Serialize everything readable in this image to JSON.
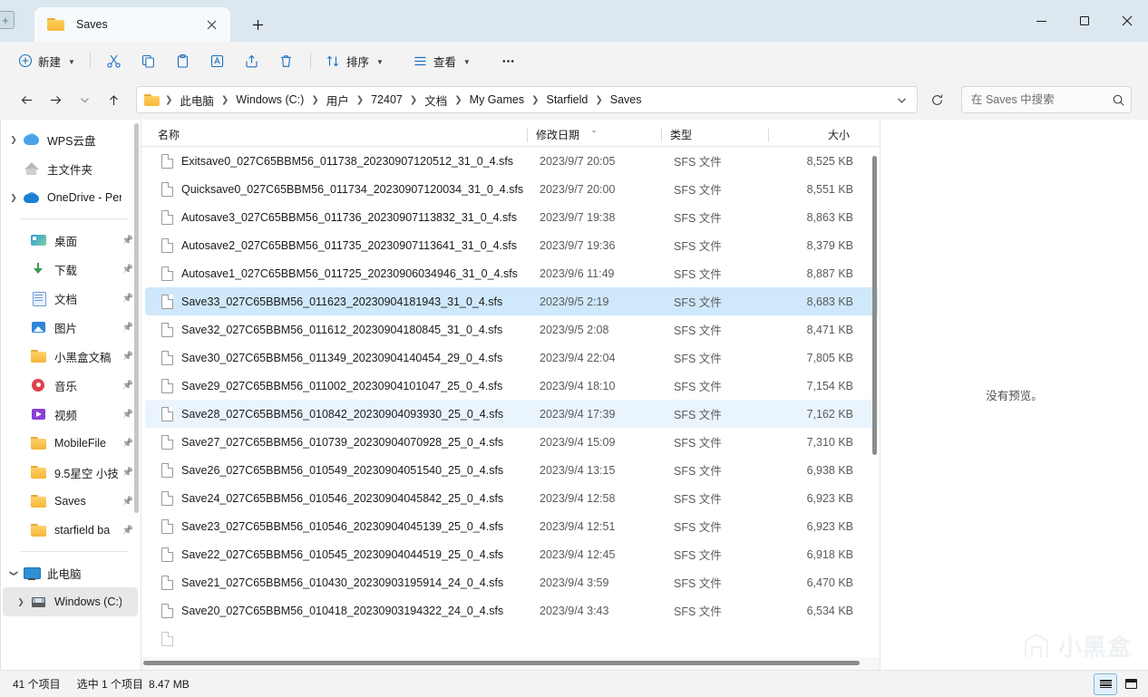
{
  "window": {
    "tab_title": "Saves",
    "controls": {
      "minimize": "–",
      "maximize": "▢",
      "close": "✕",
      "newtab": "+"
    }
  },
  "toolbar": {
    "new_label": "新建",
    "sort_label": "排序",
    "view_label": "查看",
    "more_label": "···",
    "icons": [
      "cut-icon",
      "copy-icon",
      "paste-icon",
      "rename-icon",
      "share-icon",
      "delete-icon"
    ]
  },
  "addressbar": {
    "back": "←",
    "forward": "→",
    "recent": "⌄",
    "up": "↑",
    "crumbs": [
      "此电脑",
      "Windows (C:)",
      "用户",
      "72407",
      "文档",
      "My Games",
      "Starfield",
      "Saves"
    ],
    "dropdown": "⌄",
    "refresh": "⟳",
    "search_placeholder": "在 Saves 中搜索",
    "search_value": ""
  },
  "sidebar": {
    "items": [
      {
        "label": "WPS云盘",
        "icon": "cloud-wps-icon",
        "expandable": true,
        "pinned": false,
        "indent": 0
      },
      {
        "label": "主文件夹",
        "icon": "home-icon",
        "expandable": false,
        "pinned": false,
        "indent": 0
      },
      {
        "label": "OneDrive - Per",
        "icon": "cloud-onedrive-icon",
        "expandable": true,
        "pinned": false,
        "indent": 0
      },
      {
        "separator": true
      },
      {
        "label": "桌面",
        "icon": "desktop-icon",
        "expandable": false,
        "pinned": true,
        "indent": 1
      },
      {
        "label": "下载",
        "icon": "download-icon",
        "expandable": false,
        "pinned": true,
        "indent": 1
      },
      {
        "label": "文档",
        "icon": "documents-icon",
        "expandable": false,
        "pinned": true,
        "indent": 1
      },
      {
        "label": "图片",
        "icon": "pictures-icon",
        "expandable": false,
        "pinned": true,
        "indent": 1
      },
      {
        "label": "小黑盒文稿",
        "icon": "folder-icon",
        "expandable": false,
        "pinned": true,
        "indent": 1
      },
      {
        "label": "音乐",
        "icon": "music-icon",
        "expandable": false,
        "pinned": true,
        "indent": 1
      },
      {
        "label": "视频",
        "icon": "video-icon",
        "expandable": false,
        "pinned": true,
        "indent": 1
      },
      {
        "label": "MobileFile",
        "icon": "folder-icon",
        "expandable": false,
        "pinned": true,
        "indent": 1
      },
      {
        "label": "9.5星空 小技",
        "icon": "folder-icon",
        "expandable": false,
        "pinned": true,
        "indent": 1
      },
      {
        "label": "Saves",
        "icon": "folder-icon",
        "expandable": false,
        "pinned": true,
        "indent": 1
      },
      {
        "label": "starfield ba",
        "icon": "folder-icon",
        "expandable": false,
        "pinned": true,
        "indent": 1
      },
      {
        "separator": true
      },
      {
        "label": "此电脑",
        "icon": "pc-icon",
        "expandable": true,
        "expanded": true,
        "pinned": false,
        "indent": 0
      },
      {
        "label": "Windows (C:)",
        "icon": "drive-icon",
        "expandable": true,
        "pinned": false,
        "indent": 1,
        "active": true
      }
    ]
  },
  "filelist": {
    "columns": [
      {
        "key": "name",
        "label": "名称"
      },
      {
        "key": "date",
        "label": "修改日期",
        "sorted": true,
        "sort_dir": "desc"
      },
      {
        "key": "type",
        "label": "类型"
      },
      {
        "key": "size",
        "label": "大小"
      }
    ],
    "rows": [
      {
        "name": "Exitsave0_027C65BBM56_011738_20230907120512_31_0_4.sfs",
        "date": "2023/9/7 20:05",
        "type": "SFS 文件",
        "size": "8,525 KB",
        "state": "normal"
      },
      {
        "name": "Quicksave0_027C65BBM56_011734_20230907120034_31_0_4.sfs",
        "date": "2023/9/7 20:00",
        "type": "SFS 文件",
        "size": "8,551 KB",
        "state": "normal"
      },
      {
        "name": "Autosave3_027C65BBM56_011736_20230907113832_31_0_4.sfs",
        "date": "2023/9/7 19:38",
        "type": "SFS 文件",
        "size": "8,863 KB",
        "state": "normal"
      },
      {
        "name": "Autosave2_027C65BBM56_011735_20230907113641_31_0_4.sfs",
        "date": "2023/9/7 19:36",
        "type": "SFS 文件",
        "size": "8,379 KB",
        "state": "normal"
      },
      {
        "name": "Autosave1_027C65BBM56_011725_20230906034946_31_0_4.sfs",
        "date": "2023/9/6 11:49",
        "type": "SFS 文件",
        "size": "8,887 KB",
        "state": "normal"
      },
      {
        "name": "Save33_027C65BBM56_011623_20230904181943_31_0_4.sfs",
        "date": "2023/9/5 2:19",
        "type": "SFS 文件",
        "size": "8,683 KB",
        "state": "selected"
      },
      {
        "name": "Save32_027C65BBM56_011612_20230904180845_31_0_4.sfs",
        "date": "2023/9/5 2:08",
        "type": "SFS 文件",
        "size": "8,471 KB",
        "state": "normal"
      },
      {
        "name": "Save30_027C65BBM56_011349_20230904140454_29_0_4.sfs",
        "date": "2023/9/4 22:04",
        "type": "SFS 文件",
        "size": "7,805 KB",
        "state": "normal"
      },
      {
        "name": "Save29_027C65BBM56_011002_20230904101047_25_0_4.sfs",
        "date": "2023/9/4 18:10",
        "type": "SFS 文件",
        "size": "7,154 KB",
        "state": "normal"
      },
      {
        "name": "Save28_027C65BBM56_010842_20230904093930_25_0_4.sfs",
        "date": "2023/9/4 17:39",
        "type": "SFS 文件",
        "size": "7,162 KB",
        "state": "hover"
      },
      {
        "name": "Save27_027C65BBM56_010739_20230904070928_25_0_4.sfs",
        "date": "2023/9/4 15:09",
        "type": "SFS 文件",
        "size": "7,310 KB",
        "state": "normal"
      },
      {
        "name": "Save26_027C65BBM56_010549_20230904051540_25_0_4.sfs",
        "date": "2023/9/4 13:15",
        "type": "SFS 文件",
        "size": "6,938 KB",
        "state": "normal"
      },
      {
        "name": "Save24_027C65BBM56_010546_20230904045842_25_0_4.sfs",
        "date": "2023/9/4 12:58",
        "type": "SFS 文件",
        "size": "6,923 KB",
        "state": "normal"
      },
      {
        "name": "Save23_027C65BBM56_010546_20230904045139_25_0_4.sfs",
        "date": "2023/9/4 12:51",
        "type": "SFS 文件",
        "size": "6,923 KB",
        "state": "normal"
      },
      {
        "name": "Save22_027C65BBM56_010545_20230904044519_25_0_4.sfs",
        "date": "2023/9/4 12:45",
        "type": "SFS 文件",
        "size": "6,918 KB",
        "state": "normal"
      },
      {
        "name": "Save21_027C65BBM56_010430_20230903195914_24_0_4.sfs",
        "date": "2023/9/4 3:59",
        "type": "SFS 文件",
        "size": "6,470 KB",
        "state": "normal"
      },
      {
        "name": "Save20_027C65BBM56_010418_20230903194322_24_0_4.sfs",
        "date": "2023/9/4 3:43",
        "type": "SFS 文件",
        "size": "6,534 KB",
        "state": "normal"
      }
    ]
  },
  "preview": {
    "message": "没有预览。"
  },
  "statusbar": {
    "item_count": "41 个项目",
    "selection": "选中 1 个项目",
    "selection_size": "8.47 MB"
  },
  "watermark": {
    "text": "小黑盒"
  },
  "colors": {
    "selection": "#cfe8fb",
    "hover": "#eaf4fd",
    "titlebar": "#dce7ef",
    "chrome": "#f3f3f3"
  }
}
